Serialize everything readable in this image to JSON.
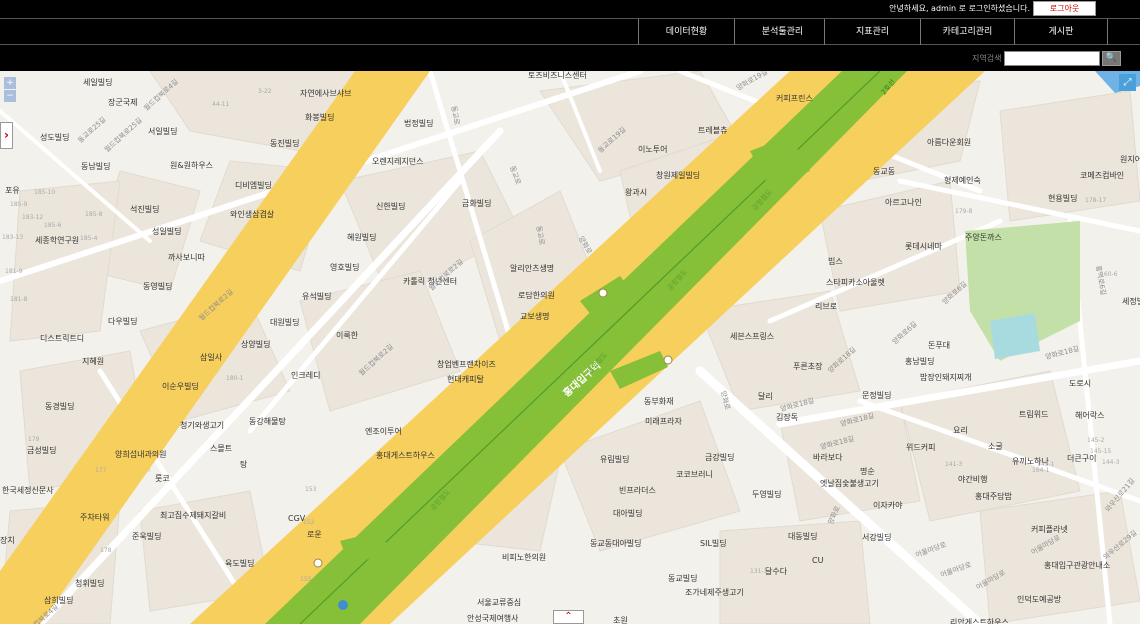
{
  "header": {
    "greeting": "안녕하세요, admin 로 로그인하셨습니다.",
    "logout": "로그아웃"
  },
  "nav": [
    "데이터현황",
    "분석툴관리",
    "지표관리",
    "카테고리관리",
    "게시판"
  ],
  "search": {
    "label": "지역검색",
    "value": "",
    "button": "🔍"
  },
  "controls": {
    "zoom_in": "+",
    "zoom_out": "−",
    "side_toggle": "›",
    "expand": "⤢",
    "bottom_toggle": "⌃"
  },
  "map": {
    "station_label": "홍대입구역",
    "colors": {
      "ground": "#f3f1ec",
      "block": "#ece6dd",
      "main_road": "#f7cf5c",
      "rail": "#86bf38",
      "park": "#c3e0a8",
      "pool": "#a7dbe0",
      "minor_road": "#ffffff"
    },
    "line_labels": [
      "2호선",
      "공항철도",
      "공항철도",
      "공항철도",
      "공항철도"
    ],
    "labels": [
      "세일빌딩",
      "장군국제",
      "서일빌딩",
      "성도빌딩",
      "동남빌딩",
      "원&원하우스",
      "포유",
      "석진빌딩",
      "세종학연구원",
      "성일빌딩",
      "까사보니따",
      "동영빌딩",
      "다우빌딩",
      "디스트릭트디",
      "지혜원",
      "삼일사",
      "이순우빌딩",
      "동경빌딩",
      "금성빌딩",
      "청기와생고기",
      "스몰트",
      "탕",
      "양희섭내과의원",
      "룻코",
      "한국세정신문사",
      "주차타워",
      "최고집수제돼지갈비",
      "준욱빌딩",
      "청휘빌딩",
      "삼희빌딩",
      "육도빌딩",
      "장치",
      "자연에사브샤브",
      "화봉빌딩",
      "동진빌딩",
      "디비엠빌딩",
      "와인생삼겹살",
      "법정빌딩",
      "오렌지레지던스",
      "신한빌딩",
      "혜원빌딩",
      "영호빌딩",
      "유석빌딩",
      "대원빌딩",
      "상양빌딩",
      "인크레디",
      "동강해물탕",
      "엔조이투어",
      "홍대게스트하우스",
      "CGV",
      "로운",
      "카톨릭 청년센터",
      "이룩한",
      "금화빌딩",
      "알리안츠생명",
      "로담한의원",
      "교보생명",
      "창업벤프랜차이즈",
      "현대캐피탈",
      "비피노한의원",
      "서울교류중심",
      "안성국제여행사",
      "토즈비즈니스센터",
      "커피프린스",
      "이노투어",
      "트레블츄",
      "창원제일빌딩",
      "왕과시",
      "동부화재",
      "미래프라자",
      "유림빌딩",
      "금강빌딩",
      "코코브러니",
      "빈프라더스",
      "대아빌딩",
      "두영빌딩",
      "동교동대아빌딩",
      "SIL빌딩",
      "대동빌딩",
      "CU",
      "달수다",
      "동교빌딩",
      "조가네제주생고기",
      "초원",
      "세븐스프링스",
      "푸른초장",
      "달리",
      "김장독",
      "리브로",
      "빕스",
      "스타피카소아울렛",
      "롯데시네마",
      "아르고나인",
      "동교동",
      "아름다운회원",
      "형제예인숙",
      "코메즈컴바인",
      "현용빌딩",
      "주양돈까스",
      "돈푸대",
      "홍남빌딩",
      "밥장인돼지찌개",
      "문정빌딩",
      "바라보다",
      "명순",
      "위드커피",
      "요리",
      "소굴",
      "유끼노하나",
      "더큰구이",
      "트림위드",
      "도로시",
      "해어락스",
      "야간비행",
      "홍대주담밥",
      "엣날집숯불생고기",
      "이자카야",
      "서강빌딩",
      "커피플라넷",
      "홍대입구관광안내소",
      "인덕도예공방",
      "리안게스트하우스",
      "세정빌딩",
      "원지어린이",
      "대성"
    ],
    "road_names": [
      "월드컵북로4길",
      "월드컵북로25길",
      "동교로25길",
      "동교로",
      "동교로",
      "월드컵북로2길",
      "월드컵북로2길",
      "월드컵북로2길",
      "동교로19길",
      "동교로",
      "양화로",
      "양화로",
      "양화로",
      "양화로18길",
      "양화로18길",
      "양화로18길",
      "양화로18길",
      "양화로6길",
      "양화로6길",
      "양화로18길",
      "어울마당로",
      "어울마당로",
      "어울마당로",
      "어울마당로",
      "홍익로6길",
      "와우산로21길",
      "와우산로29길",
      "양화로19길",
      "월드컵북로4길"
    ],
    "lot_numbers": [
      "44-11",
      "3-22",
      "185-10",
      "185-9",
      "185-8",
      "185-6",
      "185-4",
      "183-12",
      "183-13",
      "181-9",
      "181-8",
      "179",
      "178",
      "177",
      "152",
      "153",
      "180-1",
      "179-8",
      "178-17",
      "160-6",
      "145-2",
      "145-15",
      "144-3",
      "141-3",
      "143-1",
      "131-1",
      "164-1",
      "155"
    ]
  }
}
